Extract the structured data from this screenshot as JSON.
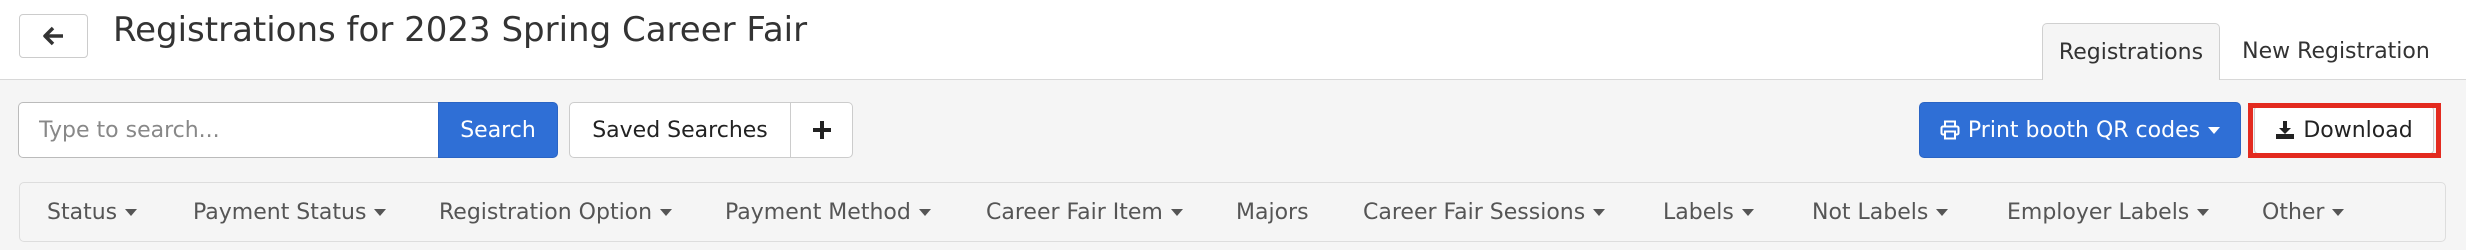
{
  "header": {
    "title": "Registrations for 2023 Spring Career Fair",
    "back_icon": "arrow-left-icon",
    "tabs": [
      {
        "label": "Registrations",
        "active": true
      },
      {
        "label": "New Registration",
        "active": false
      }
    ]
  },
  "search": {
    "placeholder": "Type to search...",
    "value": "",
    "button_label": "Search"
  },
  "saved_searches": {
    "label": "Saved Searches",
    "add_icon": "plus-icon"
  },
  "actions": {
    "print_label": "Print booth QR codes",
    "print_icon": "printer-icon",
    "download_label": "Download",
    "download_icon": "download-icon"
  },
  "filters": [
    {
      "label": "Status",
      "dropdown": true
    },
    {
      "label": "Payment Status",
      "dropdown": true
    },
    {
      "label": "Registration Option",
      "dropdown": true
    },
    {
      "label": "Payment Method",
      "dropdown": true
    },
    {
      "label": "Career Fair Item",
      "dropdown": true
    },
    {
      "label": "Majors",
      "dropdown": false
    },
    {
      "label": "Career Fair Sessions",
      "dropdown": true
    },
    {
      "label": "Labels",
      "dropdown": true
    },
    {
      "label": "Not Labels",
      "dropdown": true
    },
    {
      "label": "Employer Labels",
      "dropdown": true
    },
    {
      "label": "Other",
      "dropdown": true
    }
  ],
  "colors": {
    "primary": "#2f6fd6",
    "highlight": "#e32a1f",
    "page_bg": "#f5f5f5"
  }
}
